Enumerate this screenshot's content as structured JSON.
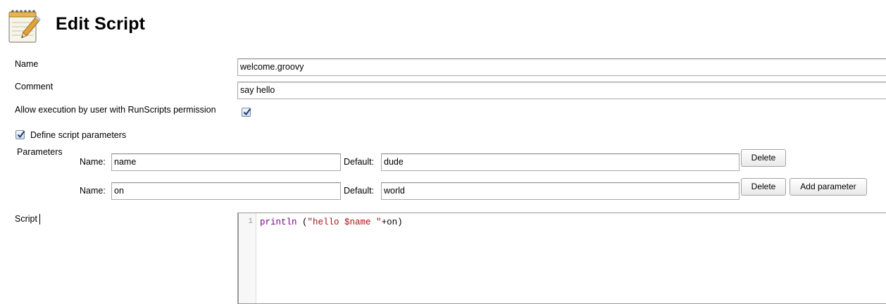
{
  "header": {
    "title": "Edit Script",
    "icon": "notepad-icon"
  },
  "form": {
    "name_label": "Name",
    "name_value": "welcome.groovy",
    "comment_label": "Comment",
    "comment_value": "say hello",
    "allow_label": "Allow execution by user with RunScripts permission",
    "allow_checked": true,
    "define_params_label": "Define script parameters",
    "define_params_checked": true,
    "parameters_label": "Parameters",
    "parameters": [
      {
        "name_label": "Name:",
        "name": "name",
        "default_label": "Default:",
        "default": "dude",
        "delete_label": "Delete"
      },
      {
        "name_label": "Name:",
        "name": "on",
        "default_label": "Default:",
        "default": "world",
        "delete_label": "Delete"
      }
    ],
    "add_parameter_label": "Add parameter",
    "script_label": "Script",
    "script": {
      "line_number": "1",
      "keyword": "println",
      "open": " (",
      "string": "\"hello $name \"",
      "rest": "+on)"
    }
  },
  "colors": {
    "keyword": "#770088",
    "string": "#aa1111",
    "border": "#a9a9a9"
  }
}
